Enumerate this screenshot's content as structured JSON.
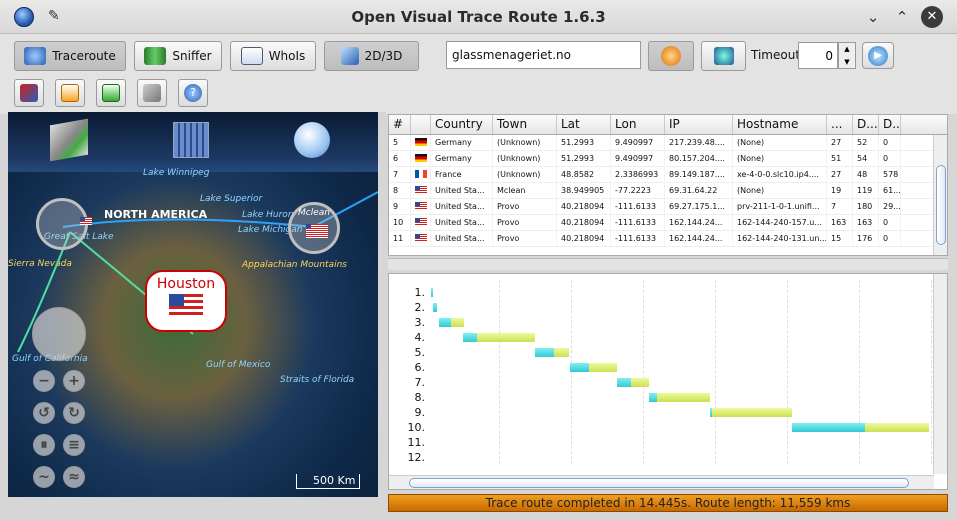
{
  "window": {
    "title": "Open Visual Trace Route 1.6.3",
    "min": "⌄",
    "max": "⌃",
    "close": "✕"
  },
  "toolbar": {
    "traceroute": "Traceroute",
    "sniffer": "Sniffer",
    "whois": "WhoIs",
    "view_mode": "2D/3D",
    "host_value": "glassmenageriet.no",
    "timeout_label": "Timeout",
    "timeout_value": "0"
  },
  "map": {
    "continent": "NORTH AMERICA",
    "callout": "Houston",
    "compass_label": "Mclean",
    "scale": "500 Km",
    "labels": {
      "winnipeg": "Lake Winnipeg",
      "superior": "Lake Superior",
      "huron": "Lake Huron",
      "michigan": "Lake Michigan",
      "appalachian": "Appalachian Mountains",
      "sierra": "Sierra Nevada",
      "greatsalt": "Great Salt Lake",
      "california": "Gulf of California",
      "mexico": "Gulf of Mexico",
      "florida": "Straits of Florida"
    }
  },
  "table": {
    "headers": [
      "#",
      "",
      "Country",
      "Town",
      "Lat",
      "Lon",
      "IP",
      "Hostname",
      "...",
      "D...",
      "D..."
    ],
    "rows": [
      {
        "n": "5",
        "flag": "de",
        "country": "Germany",
        "town": "(Unknown)",
        "lat": "51.2993",
        "lon": "9.490997",
        "ip": "217.239.48....",
        "host": "(None)",
        "a": "27",
        "b": "52",
        "c": "0"
      },
      {
        "n": "6",
        "flag": "de",
        "country": "Germany",
        "town": "(Unknown)",
        "lat": "51.2993",
        "lon": "9.490997",
        "ip": "80.157.204....",
        "host": "(None)",
        "a": "51",
        "b": "54",
        "c": "0"
      },
      {
        "n": "7",
        "flag": "fr",
        "country": "France",
        "town": "(Unknown)",
        "lat": "48.8582",
        "lon": "2.3386993",
        "ip": "89.149.187....",
        "host": "xe-4-0-0.slc10.ip4....",
        "a": "27",
        "b": "48",
        "c": "578"
      },
      {
        "n": "8",
        "flag": "us",
        "country": "United Sta...",
        "town": "Mclean",
        "lat": "38.949905",
        "lon": "-77.2223",
        "ip": "69.31.64.22",
        "host": "(None)",
        "a": "19",
        "b": "119",
        "c": "61..."
      },
      {
        "n": "9",
        "flag": "us",
        "country": "United Sta...",
        "town": "Provo",
        "lat": "40.218094",
        "lon": "-111.6133",
        "ip": "69.27.175.1...",
        "host": "prv-211-1-0-1.unifi...",
        "a": "7",
        "b": "180",
        "c": "29..."
      },
      {
        "n": "10",
        "flag": "us",
        "country": "United Sta...",
        "town": "Provo",
        "lat": "40.218094",
        "lon": "-111.6133",
        "ip": "162.144.24...",
        "host": "162-144-240-157.u...",
        "a": "163",
        "b": "163",
        "c": "0"
      },
      {
        "n": "11",
        "flag": "us",
        "country": "United Sta...",
        "town": "Provo",
        "lat": "40.218094",
        "lon": "-111.6133",
        "ip": "162.144.24...",
        "host": "162-144-240-131.un...",
        "a": "15",
        "b": "176",
        "c": "0"
      }
    ]
  },
  "graph": {
    "rows": [
      "1.",
      "2.",
      "3.",
      "4.",
      "5.",
      "6.",
      "7.",
      "8.",
      "9.",
      "10.",
      "11.",
      "12."
    ]
  },
  "status": "Trace route completed in 14.445s. Route length: 11,559 kms",
  "colors": {
    "status_bg": "#e08a10",
    "callout_border": "#cc0000",
    "bar_cyan": "#33c9d6",
    "bar_yellow": "#cde052"
  }
}
